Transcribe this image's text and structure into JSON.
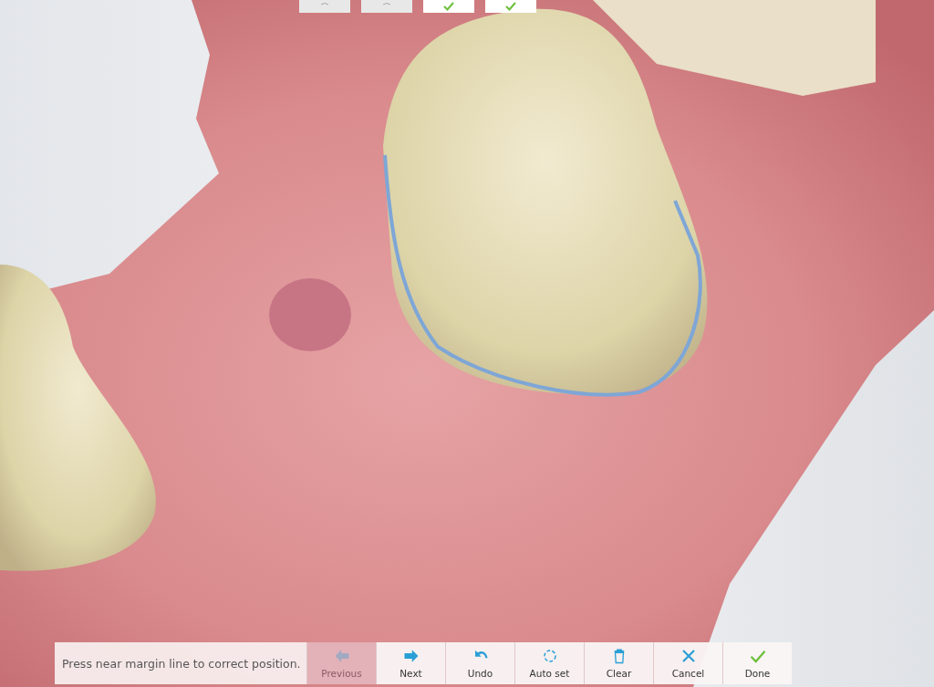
{
  "step_tabs": [
    {
      "checked": false
    },
    {
      "checked": false
    },
    {
      "checked": true
    },
    {
      "checked": true
    }
  ],
  "hint": "Press near margin line to correct position.",
  "buttons": [
    {
      "kind": "previous",
      "label": "Previous",
      "disabled": true
    },
    {
      "kind": "next",
      "label": "Next",
      "disabled": false
    },
    {
      "kind": "undo",
      "label": "Undo",
      "disabled": false
    },
    {
      "kind": "autoset",
      "label": "Auto set",
      "disabled": false
    },
    {
      "kind": "clear",
      "label": "Clear",
      "disabled": false
    },
    {
      "kind": "cancel",
      "label": "Cancel",
      "disabled": false
    },
    {
      "kind": "done",
      "label": "Done",
      "disabled": false
    }
  ]
}
